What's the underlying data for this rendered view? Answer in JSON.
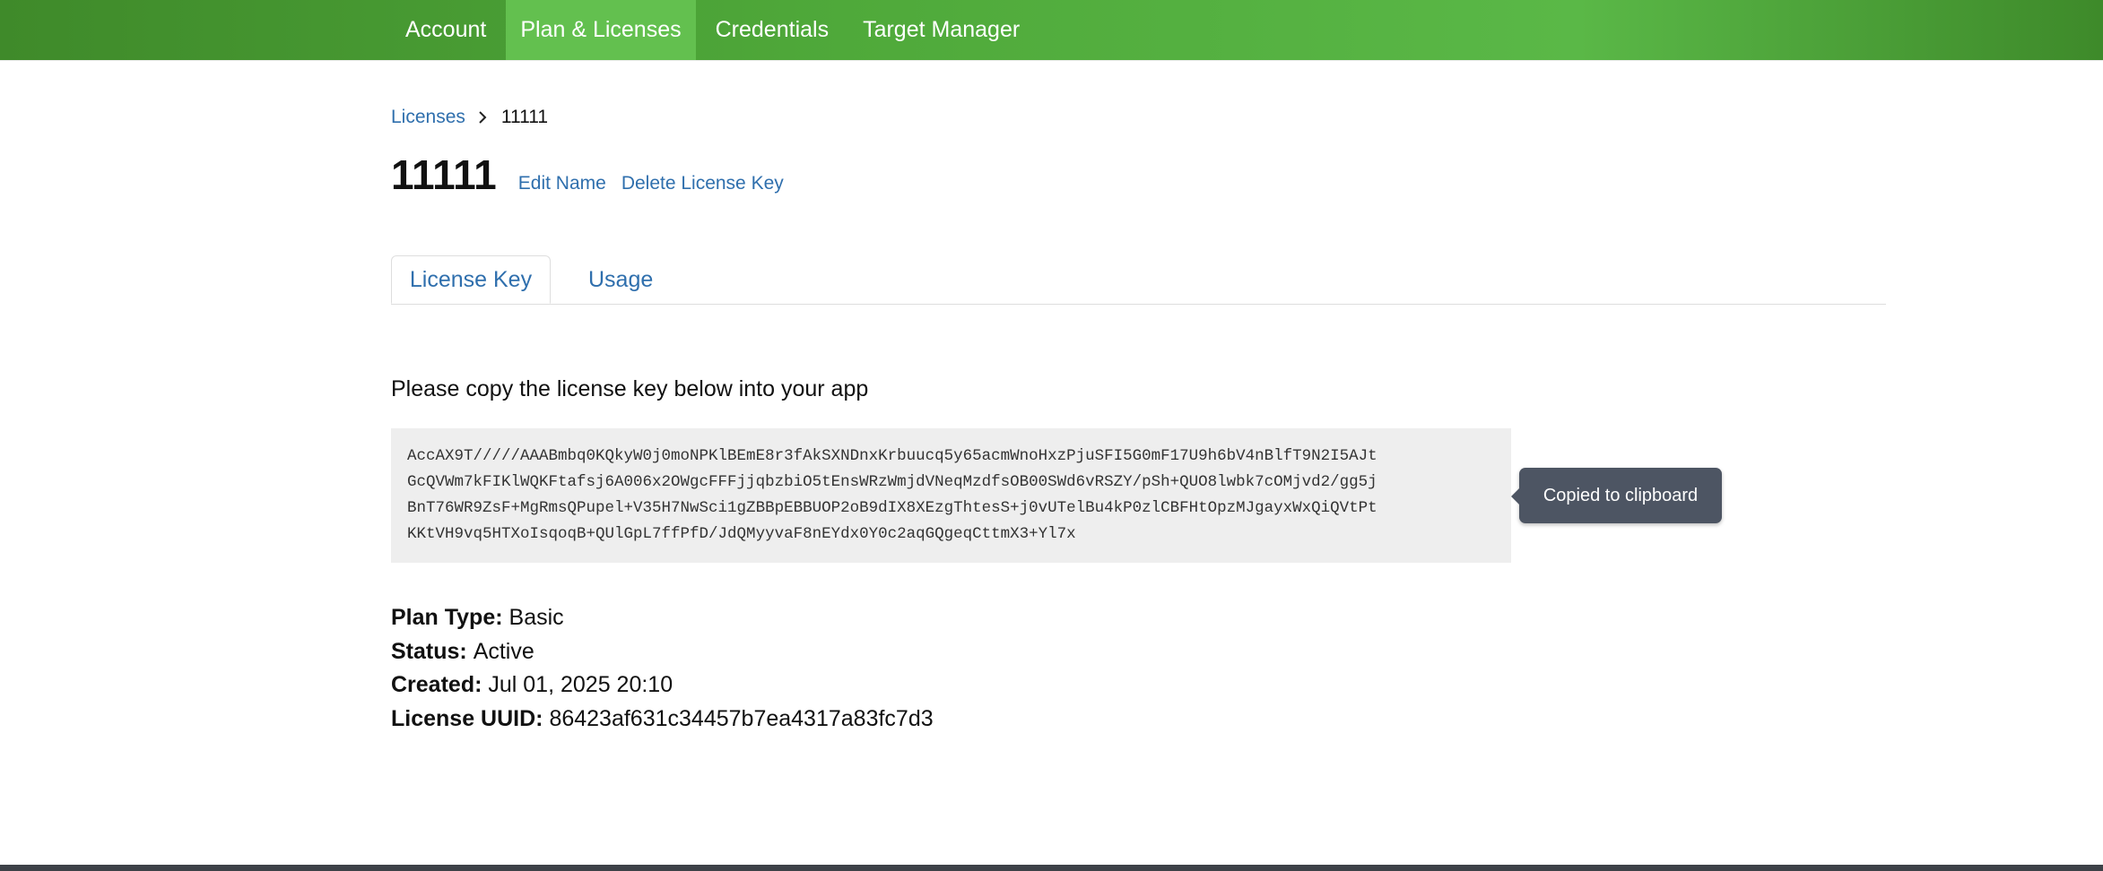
{
  "nav": {
    "items": [
      {
        "label": "Account",
        "active": false
      },
      {
        "label": "Plan & Licenses",
        "active": true
      },
      {
        "label": "Credentials",
        "active": false
      },
      {
        "label": "Target Manager",
        "active": false
      }
    ]
  },
  "breadcrumb": {
    "parent": "Licenses",
    "current": "11111"
  },
  "header": {
    "title": "11111",
    "edit_name": "Edit Name",
    "delete_key": "Delete License Key"
  },
  "tabs": [
    {
      "label": "License Key",
      "active": true
    },
    {
      "label": "Usage",
      "active": false
    }
  ],
  "license": {
    "instruction": "Please copy the license key below into your app",
    "key_lines": [
      "AccAX9T/////AAABmbq0KQkyW0j0moNPKlBEmE8r3fAkSXNDnxKrbuucq5y65acmWnoHxzPjuSFI5G0mF17U9h6bV4nBlfT9N2I5AJt",
      "GcQVWm7kFIKlWQKFtafsj6A006x2OWgcFFFjjqbzbiO5tEnsWRzWmjdVNeqMzdfsOB00SWd6vRSZY/pSh+QUO8lwbk7cOMjvd2/gg5j",
      "BnT76WR9ZsF+MgRmsQPupel+V35H7NwSci1gZBBpEBBUOP2oB9dIX8XEzgThtesS+j0vUTelBu4kP0zlCBFHtOpzMJgayxWxQiQVtPt",
      "KKtVH9vq5HTXoIsqoqB+QUlGpL7ffPfD/JdQMyyvaF8nEYdx0Y0c2aqGQgeqCttmX3+Yl7x"
    ],
    "tooltip": "Copied to clipboard",
    "fields": [
      {
        "label": "Plan Type:",
        "value": "Basic"
      },
      {
        "label": "Status:",
        "value": "Active"
      },
      {
        "label": "Created:",
        "value": "Jul 01, 2025 20:10"
      },
      {
        "label": "License UUID:",
        "value": "86423af631c34457b7ea4317a83fc7d3"
      }
    ]
  },
  "colors": {
    "header_green": "#4fa93a",
    "active_nav": "#63c04f",
    "link_blue": "#2f6fad",
    "tooltip_bg": "#4d5563",
    "footer": "#3d4147"
  }
}
